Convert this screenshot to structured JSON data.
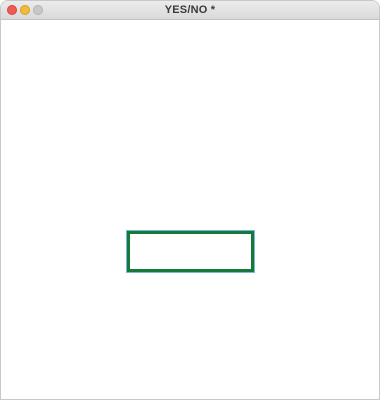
{
  "window": {
    "title": "YES/NO *"
  },
  "controls": {
    "close_icon": "close-icon",
    "minimize_icon": "minimize-icon",
    "zoom_icon": "zoom-icon"
  },
  "main": {
    "answer_box_text": ""
  },
  "colors": {
    "box_border": "#147a3a",
    "focus_ring": "#7fb6d6"
  }
}
